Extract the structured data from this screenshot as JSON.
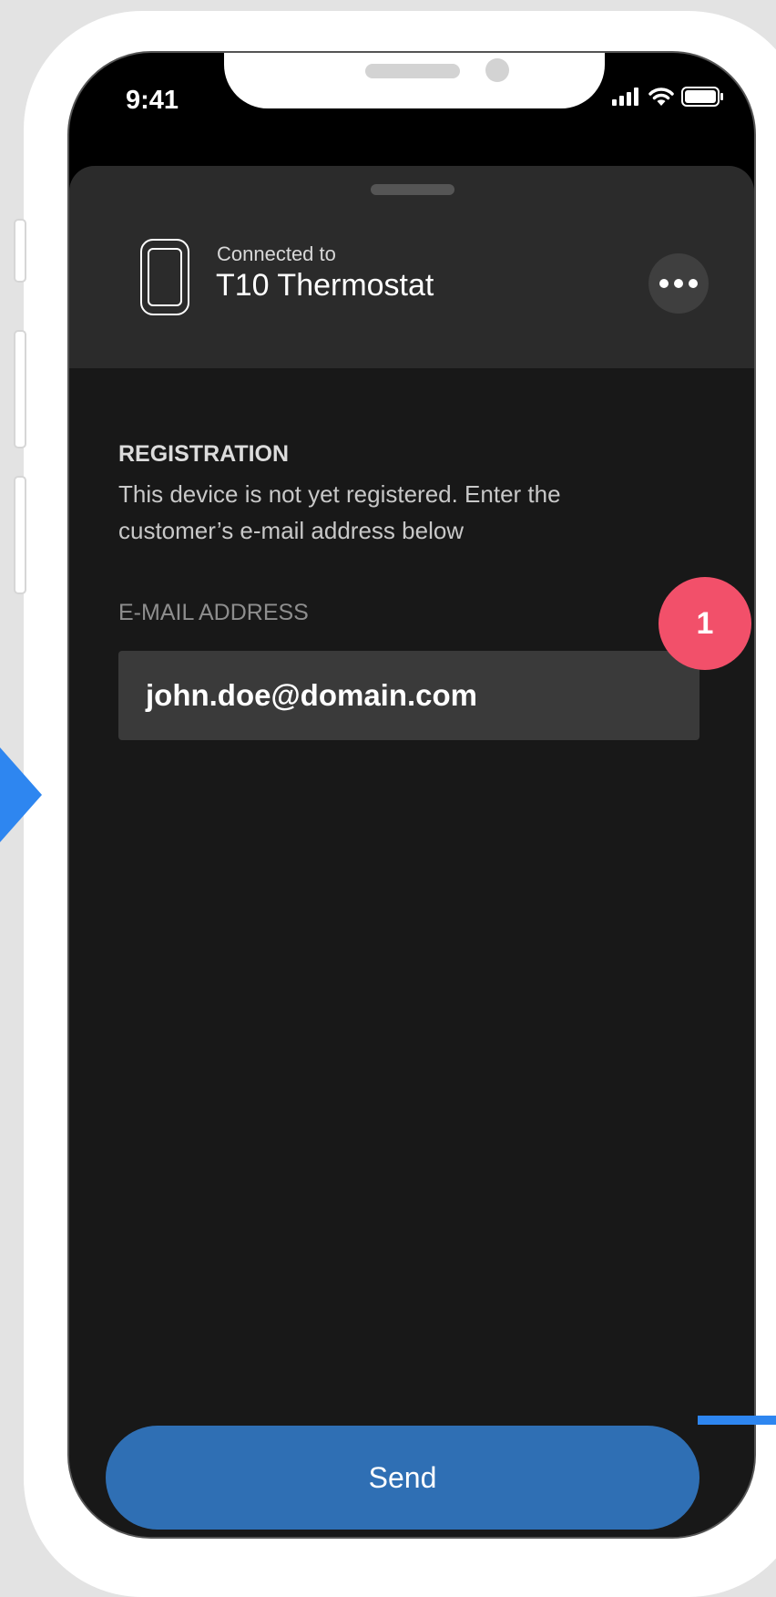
{
  "status_bar": {
    "time": "9:41"
  },
  "header": {
    "connected_label": "Connected to",
    "device_name": "T10 Thermostat",
    "device_icon": "thermostat-device-icon",
    "more_icon": "more-horizontal-icon"
  },
  "registration": {
    "title": "REGISTRATION",
    "description": "This device is not yet registered. Enter the customer’s e-mail address below"
  },
  "email": {
    "label": "E-MAIL ADDRESS",
    "value": "john.doe@domain.com"
  },
  "actions": {
    "send_label": "Send"
  },
  "annotations": {
    "badge_number": "1",
    "accent_color": "#2e86f0",
    "badge_color": "#f2506a",
    "button_color": "#2f6fb4"
  }
}
